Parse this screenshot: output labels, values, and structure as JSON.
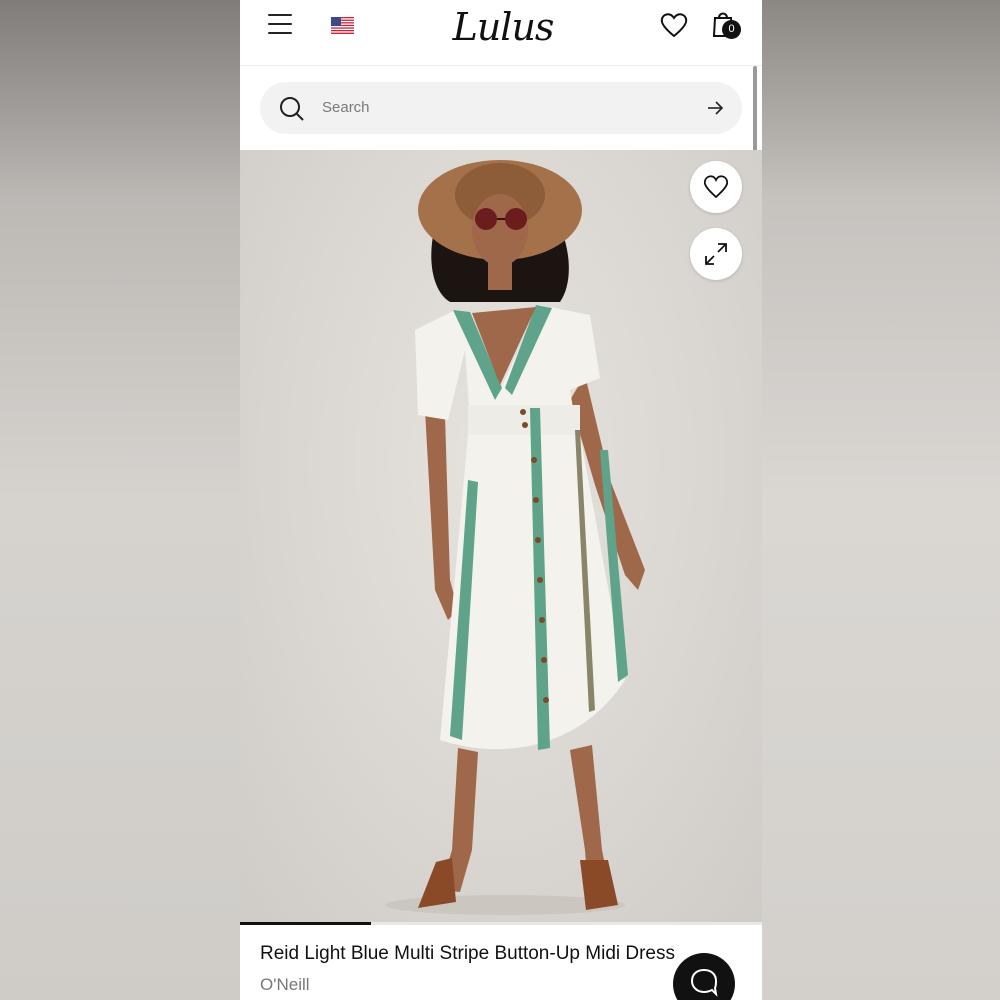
{
  "header": {
    "logo_text": "Lulus",
    "cart_count": "0",
    "menu_icon": "hamburger-menu-icon",
    "flag_icon": "us-flag-icon",
    "wishlist_icon": "heart-icon",
    "cart_icon": "shopping-bag-icon"
  },
  "search": {
    "placeholder": "Search",
    "icon": "search-icon",
    "submit_icon": "arrow-right-icon"
  },
  "product": {
    "image_alt": "Model wearing Reid Light Blue Multi Stripe Button-Up Midi Dress",
    "wishlist_icon": "heart-icon",
    "expand_icon": "expand-icon",
    "carousel_progress": 0.25,
    "title": "Reid Light Blue Multi Stripe Button-Up Midi Dress",
    "brand": "O'Neill"
  },
  "chat": {
    "icon": "chat-bubble-icon"
  },
  "colors": {
    "accent": "#111111",
    "stripe_green": "#5fa38a",
    "dress_white": "#f4f2ec",
    "hat_brown": "#a5714a"
  }
}
